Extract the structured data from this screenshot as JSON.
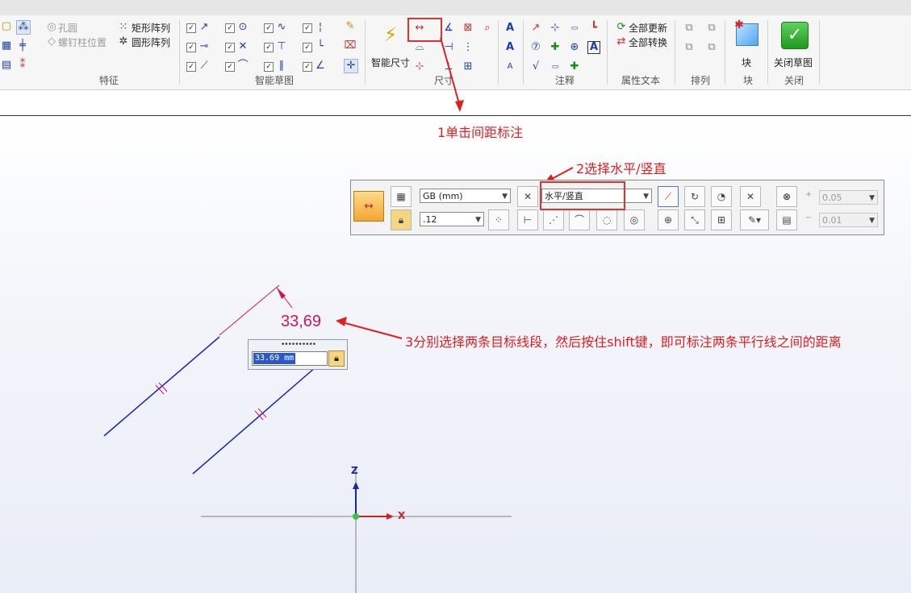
{
  "ribbon": {
    "groups": {
      "features": "特征",
      "smart_sketch": "智能草图",
      "dimension": "尺寸",
      "annotation": "注释",
      "property_text": "属性文本",
      "arrange": "排列",
      "block": "块",
      "close": "关闭"
    },
    "feature_items": {
      "hole": "孔圆",
      "bolt_pos": "螺钉柱位置",
      "rect_array": "矩形阵列",
      "circ_array": "圆形阵列"
    },
    "smart_dim_label": "智能尺寸",
    "prop_text": {
      "update_all": "全部更新",
      "convert_all": "全部转换"
    },
    "block_label": "块",
    "close_sketch_label": "关闭草图"
  },
  "annotations": {
    "step1": "1单击间距标注",
    "step2": "2选择水平/竖直",
    "step3": "3分别选择两条目标线段，然后按住shift键，即可标注两条平行线之间的距离"
  },
  "command_bar": {
    "standard": "GB (mm)",
    "precision": ".12",
    "orientation": "水平/竖直",
    "plus_sign": "+",
    "minus_sign": "−",
    "tol_plus": "0.05",
    "tol_minus": "0.01"
  },
  "canvas": {
    "dimension_value": "33,69",
    "edit_value": "33.69 mm",
    "axis_z": "Z",
    "axis_x": "X"
  },
  "colors": {
    "accent_red": "#e02020",
    "dimension": "#d0145a",
    "sketch_line": "#1a23b0"
  }
}
